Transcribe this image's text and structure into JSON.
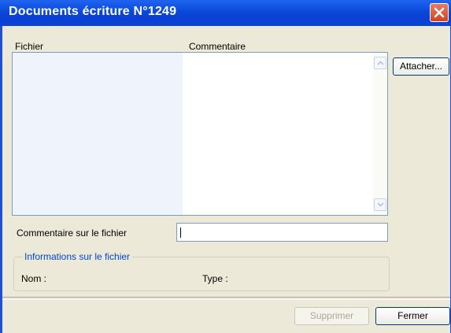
{
  "window": {
    "title": "Documents écriture N°1249",
    "accent_color": "#0a49da",
    "close_icon": "close-icon"
  },
  "grid": {
    "columns": [
      "Fichier",
      "Commentaire"
    ],
    "rows": []
  },
  "buttons": {
    "attach": "Attacher...",
    "delete": "Supprimer",
    "close": "Fermer"
  },
  "comment_field": {
    "label": "Commentaire sur le fichier",
    "value": ""
  },
  "file_info": {
    "legend": "Informations sur le fichier",
    "name_label": "Nom :",
    "type_label": "Type :"
  }
}
